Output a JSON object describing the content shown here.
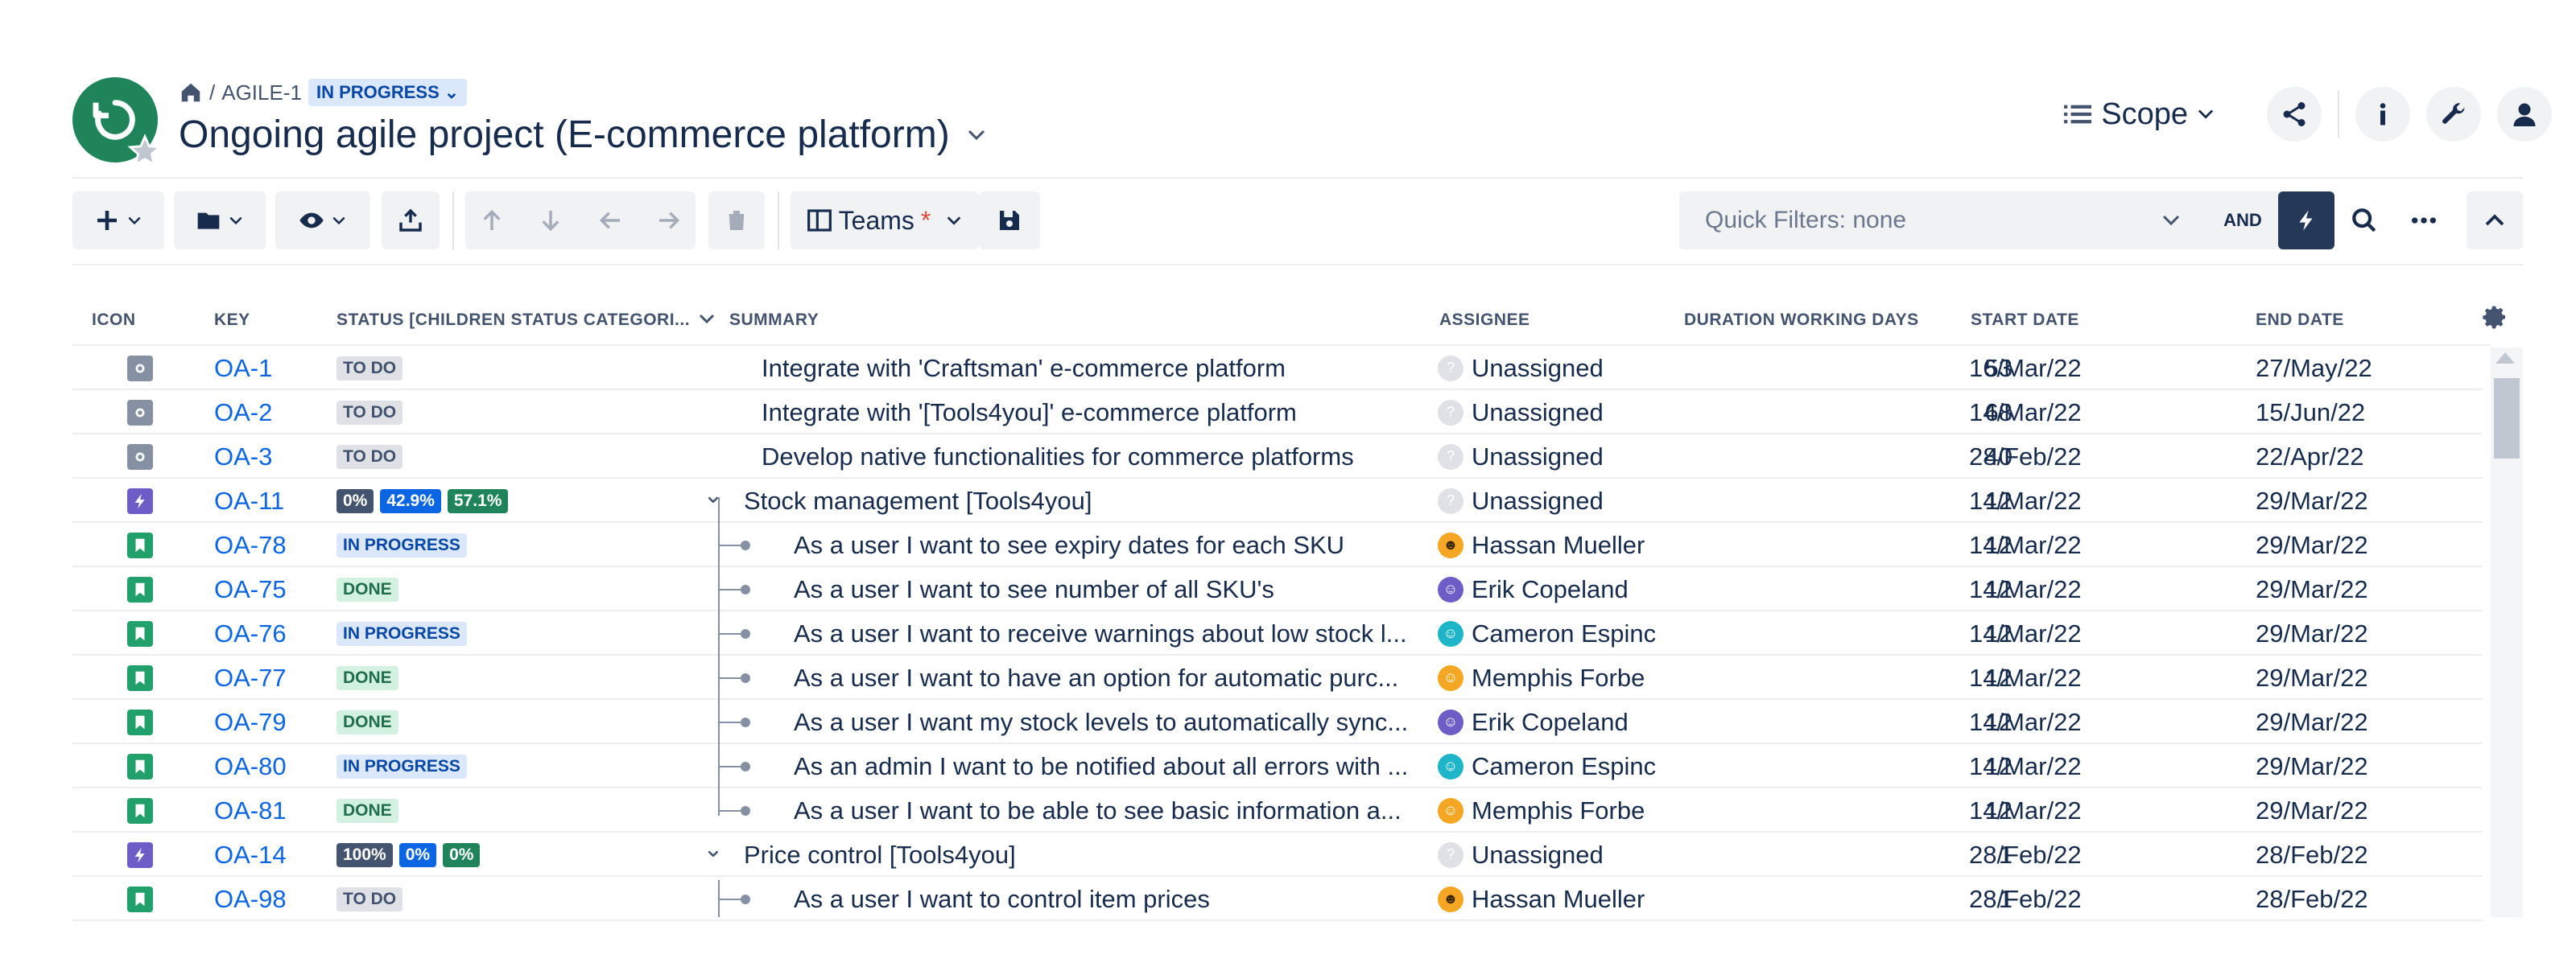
{
  "header": {
    "breadcrumb_key": "AGILE-1",
    "status": "IN PROGRESS",
    "title": "Ongoing agile project (E-commerce platform)",
    "scope_label": "Scope"
  },
  "toolbar": {
    "teams_label": "Teams",
    "teams_modified": "*",
    "quick_filters": "Quick Filters: none",
    "and_label": "AND"
  },
  "columns": {
    "icon": "ICON",
    "key": "KEY",
    "status": "STATUS [CHILDREN STATUS CATEGORI...",
    "summary": "SUMMARY",
    "assignee": "ASSIGNEE",
    "duration": "DURATION WORKING DAYS",
    "start": "START DATE",
    "end": "END DATE"
  },
  "rows": [
    {
      "type": "task",
      "key": "OA-1",
      "status": "TO DO",
      "summary": "Integrate with 'Craftsman' e-commerce platform",
      "assignee": "Unassigned",
      "duration": "53",
      "start": "16/Mar/22",
      "end": "27/May/22"
    },
    {
      "type": "task",
      "key": "OA-2",
      "status": "TO DO",
      "summary": "Integrate with '[Tools4you]' e-commerce platform",
      "assignee": "Unassigned",
      "duration": "68",
      "start": "14/Mar/22",
      "end": "15/Jun/22"
    },
    {
      "type": "task",
      "key": "OA-3",
      "status": "TO DO",
      "summary": "Develop native functionalities for commerce platforms",
      "assignee": "Unassigned",
      "duration": "40",
      "start": "28/Feb/22",
      "end": "22/Apr/22"
    },
    {
      "type": "epic",
      "key": "OA-11",
      "progress": [
        "0%",
        "42.9%",
        "57.1%"
      ],
      "summary": "Stock management [Tools4you]",
      "assignee": "Unassigned",
      "duration": "12",
      "start": "14/Mar/22",
      "end": "29/Mar/22"
    },
    {
      "type": "story",
      "key": "OA-78",
      "status": "IN PROGRESS",
      "summary": "As a user I want to see expiry dates for each SKU",
      "assignee": "Hassan Mueller",
      "duration": "12",
      "start": "14/Mar/22",
      "end": "29/Mar/22"
    },
    {
      "type": "story",
      "key": "OA-75",
      "status": "DONE",
      "summary": "As a user I want to see number of all SKU's",
      "assignee": "Erik Copeland",
      "duration": "12",
      "start": "14/Mar/22",
      "end": "29/Mar/22"
    },
    {
      "type": "story",
      "key": "OA-76",
      "status": "IN PROGRESS",
      "summary": "As a user I want to receive warnings about low stock l...",
      "assignee": "Cameron Espinc",
      "duration": "12",
      "start": "14/Mar/22",
      "end": "29/Mar/22"
    },
    {
      "type": "story",
      "key": "OA-77",
      "status": "DONE",
      "summary": "As a user I want to have an option for automatic purc...",
      "assignee": "Memphis Forbe",
      "duration": "12",
      "start": "14/Mar/22",
      "end": "29/Mar/22"
    },
    {
      "type": "story",
      "key": "OA-79",
      "status": "DONE",
      "summary": "As a user I want my stock levels to automatically sync...",
      "assignee": "Erik Copeland",
      "duration": "12",
      "start": "14/Mar/22",
      "end": "29/Mar/22"
    },
    {
      "type": "story",
      "key": "OA-80",
      "status": "IN PROGRESS",
      "summary": "As an admin I want to be notified about all errors with ...",
      "assignee": "Cameron Espinc",
      "duration": "12",
      "start": "14/Mar/22",
      "end": "29/Mar/22"
    },
    {
      "type": "story",
      "key": "OA-81",
      "status": "DONE",
      "summary": "As a user I want to be able to see basic information a...",
      "assignee": "Memphis Forbe",
      "duration": "12",
      "start": "14/Mar/22",
      "end": "29/Mar/22"
    },
    {
      "type": "epic",
      "key": "OA-14",
      "progress": [
        "100%",
        "0%",
        "0%"
      ],
      "summary": "Price control [Tools4you]",
      "assignee": "Unassigned",
      "duration": "1",
      "start": "28/Feb/22",
      "end": "28/Feb/22"
    },
    {
      "type": "story",
      "key": "OA-98",
      "status": "TO DO",
      "summary": "As a user I want to control item prices",
      "assignee": "Hassan Mueller",
      "duration": "1",
      "start": "28/Feb/22",
      "end": "28/Feb/22"
    }
  ],
  "colors": {
    "task": "#8590a2",
    "epic": "#6e5dc6",
    "story": "#22a06b",
    "link": "#0c66e4"
  },
  "icons": [
    "home-icon",
    "scope-list-icon",
    "share-icon",
    "info-icon",
    "wrench-icon",
    "user-icon",
    "plus-icon",
    "folder-icon",
    "eye-icon",
    "export-icon",
    "arrow-up-icon",
    "arrow-down-icon",
    "arrow-left-icon",
    "arrow-right-icon",
    "trash-icon",
    "columns-icon",
    "save-icon",
    "bolt-icon",
    "search-icon",
    "more-icon",
    "chevron-up-icon",
    "gear-icon"
  ]
}
